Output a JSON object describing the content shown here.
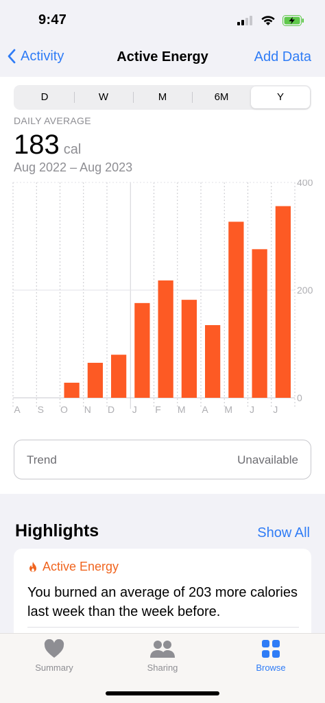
{
  "status_bar": {
    "time": "9:47"
  },
  "nav": {
    "back_label": "Activity",
    "title": "Active Energy",
    "add_label": "Add Data"
  },
  "segments": [
    {
      "label": "D",
      "selected": false
    },
    {
      "label": "W",
      "selected": false
    },
    {
      "label": "M",
      "selected": false
    },
    {
      "label": "6M",
      "selected": false
    },
    {
      "label": "Y",
      "selected": true
    }
  ],
  "summary": {
    "label": "DAILY AVERAGE",
    "value": "183",
    "unit": "cal",
    "range": "Aug 2022 – Aug 2023"
  },
  "chart_data": {
    "type": "bar",
    "categories": [
      "A",
      "S",
      "O",
      "N",
      "D",
      "J",
      "F",
      "M",
      "A",
      "M",
      "J",
      "J"
    ],
    "values": [
      0,
      0,
      28,
      65,
      80,
      176,
      218,
      182,
      135,
      327,
      276,
      356
    ],
    "ylim": [
      0,
      400
    ],
    "y_ticks": [
      "0",
      "200",
      "400"
    ],
    "bar_color": "#fd5a24",
    "grid": true
  },
  "trend": {
    "label": "Trend",
    "value": "Unavailable"
  },
  "highlights": {
    "title": "Highlights",
    "show_all": "Show All",
    "card": {
      "category": "Active Energy",
      "text": "You burned an average of 203 more calories last week than the week before."
    }
  },
  "tabs": [
    {
      "label": "Summary",
      "icon": "heart-icon",
      "active": false
    },
    {
      "label": "Sharing",
      "icon": "people-icon",
      "active": false
    },
    {
      "label": "Browse",
      "icon": "grid-icon",
      "active": true
    }
  ],
  "colors": {
    "accent": "#2f7cf6",
    "energy": "#fd5a24",
    "secondary_text": "#8e8e93"
  }
}
